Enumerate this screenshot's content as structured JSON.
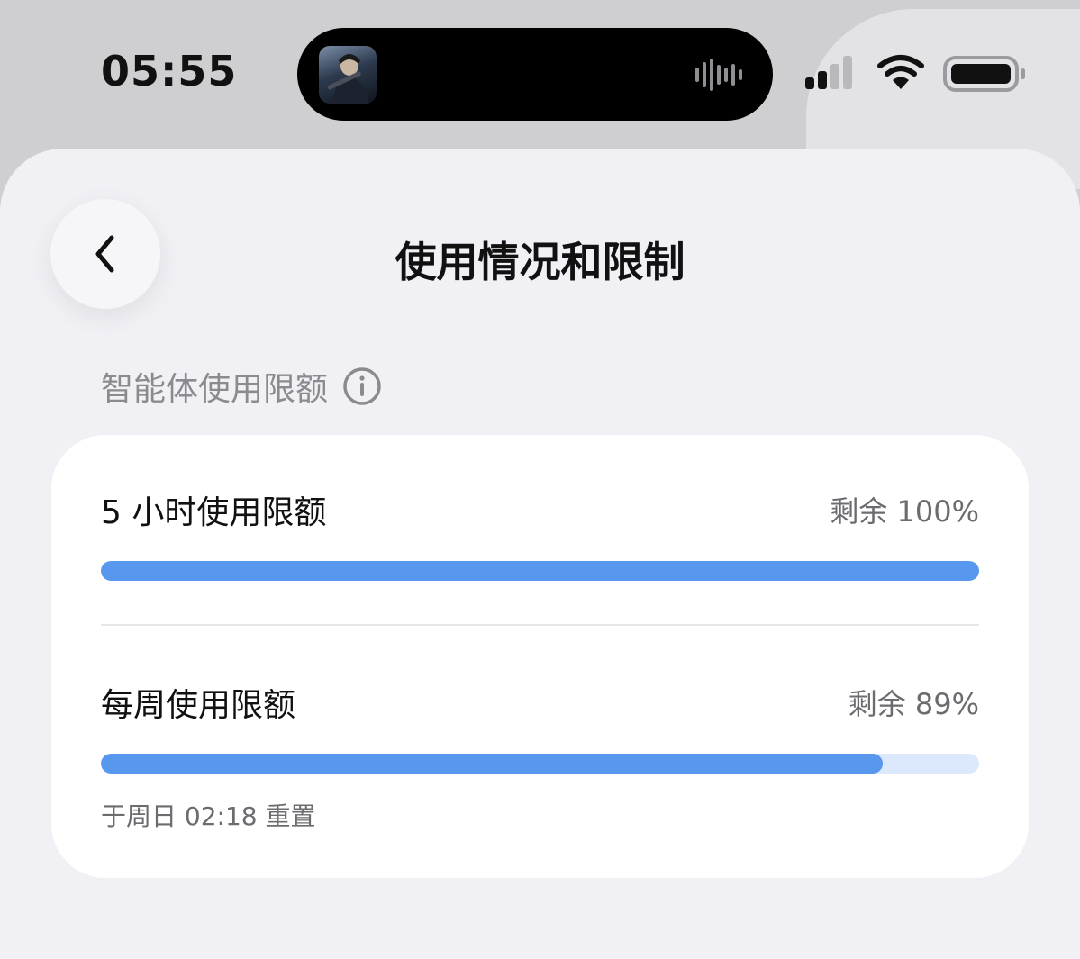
{
  "status_bar": {
    "time": "05:55",
    "icons": [
      "now-playing-artwork",
      "audio-waveform-icon",
      "cellular-signal-icon",
      "wifi-icon",
      "battery-icon"
    ]
  },
  "header": {
    "back_icon": "chevron-left-icon",
    "title": "使用情况和限制"
  },
  "section": {
    "title": "智能体使用限额",
    "info_icon": "info-icon"
  },
  "limits": [
    {
      "label": "5 小时使用限额",
      "remaining_text": "剩余 100%",
      "remaining_fraction": 1.0
    },
    {
      "label": "每周使用限额",
      "remaining_text": "剩余 89%",
      "remaining_fraction": 0.89,
      "reset_text": "于周日 02:18 重置"
    }
  ],
  "colors": {
    "accent": "#5797ee",
    "track": "#dce8fb",
    "sheet_background": "#f0f0f5",
    "card_background": "#ffffff",
    "secondary_text": "#8a8a8f"
  }
}
